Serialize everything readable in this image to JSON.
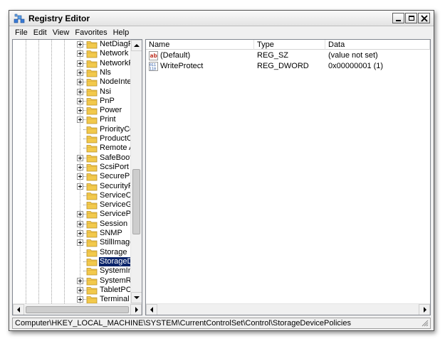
{
  "window": {
    "title": "Registry Editor",
    "icon": "regedit-icon",
    "controls": [
      "minimize-icon",
      "maximize-icon",
      "close-icon"
    ]
  },
  "menubar": {
    "items": [
      {
        "label": "File"
      },
      {
        "label": "Edit"
      },
      {
        "label": "View"
      },
      {
        "label": "Favorites"
      },
      {
        "label": "Help"
      }
    ]
  },
  "tree": {
    "items": [
      {
        "label": "NetDiagFx",
        "expandable": true,
        "selected": false
      },
      {
        "label": "Network",
        "expandable": true,
        "selected": false
      },
      {
        "label": "NetworkProv",
        "expandable": true,
        "selected": false
      },
      {
        "label": "Nls",
        "expandable": true,
        "selected": false
      },
      {
        "label": "NodeInterfa",
        "expandable": true,
        "selected": false
      },
      {
        "label": "Nsi",
        "expandable": true,
        "selected": false
      },
      {
        "label": "PnP",
        "expandable": true,
        "selected": false
      },
      {
        "label": "Power",
        "expandable": true,
        "selected": false
      },
      {
        "label": "Print",
        "expandable": true,
        "selected": false
      },
      {
        "label": "PriorityContr",
        "expandable": false,
        "selected": false
      },
      {
        "label": "ProductOptio",
        "expandable": false,
        "selected": false
      },
      {
        "label": "Remote Assi",
        "expandable": false,
        "selected": false
      },
      {
        "label": "SafeBoot",
        "expandable": true,
        "selected": false
      },
      {
        "label": "ScsiPort",
        "expandable": true,
        "selected": false
      },
      {
        "label": "SecurePipeS",
        "expandable": true,
        "selected": false
      },
      {
        "label": "SecurityProv",
        "expandable": true,
        "selected": false
      },
      {
        "label": "ServiceCurre",
        "expandable": false,
        "selected": false
      },
      {
        "label": "ServiceGrou",
        "expandable": false,
        "selected": false
      },
      {
        "label": "ServiceProvi",
        "expandable": true,
        "selected": false
      },
      {
        "label": "Session Man",
        "expandable": true,
        "selected": false
      },
      {
        "label": "SNMP",
        "expandable": true,
        "selected": false
      },
      {
        "label": "StillImage",
        "expandable": true,
        "selected": false
      },
      {
        "label": "Storage",
        "expandable": false,
        "selected": false
      },
      {
        "label": "StorageDevic",
        "expandable": false,
        "selected": true
      },
      {
        "label": "SystemInfor",
        "expandable": false,
        "selected": false
      },
      {
        "label": "SystemReso",
        "expandable": true,
        "selected": false
      },
      {
        "label": "TabletPC",
        "expandable": true,
        "selected": false
      },
      {
        "label": "Terminal Ser",
        "expandable": true,
        "selected": false
      }
    ]
  },
  "list": {
    "columns": [
      {
        "label": "Name"
      },
      {
        "label": "Type"
      },
      {
        "label": "Data"
      }
    ],
    "rows": [
      {
        "icon": "string-value-icon",
        "name": "(Default)",
        "type": "REG_SZ",
        "data": "(value not set)"
      },
      {
        "icon": "binary-value-icon",
        "name": "WriteProtect",
        "type": "REG_DWORD",
        "data": "0x00000001 (1)"
      }
    ]
  },
  "statusbar": {
    "path": "Computer\\HKEY_LOCAL_MACHINE\\SYSTEM\\CurrentControlSet\\Control\\StorageDevicePolicies"
  },
  "colors": {
    "selection": "#0a246a",
    "folder": "#f2c94c",
    "window_bg": "#f0f0f0"
  }
}
